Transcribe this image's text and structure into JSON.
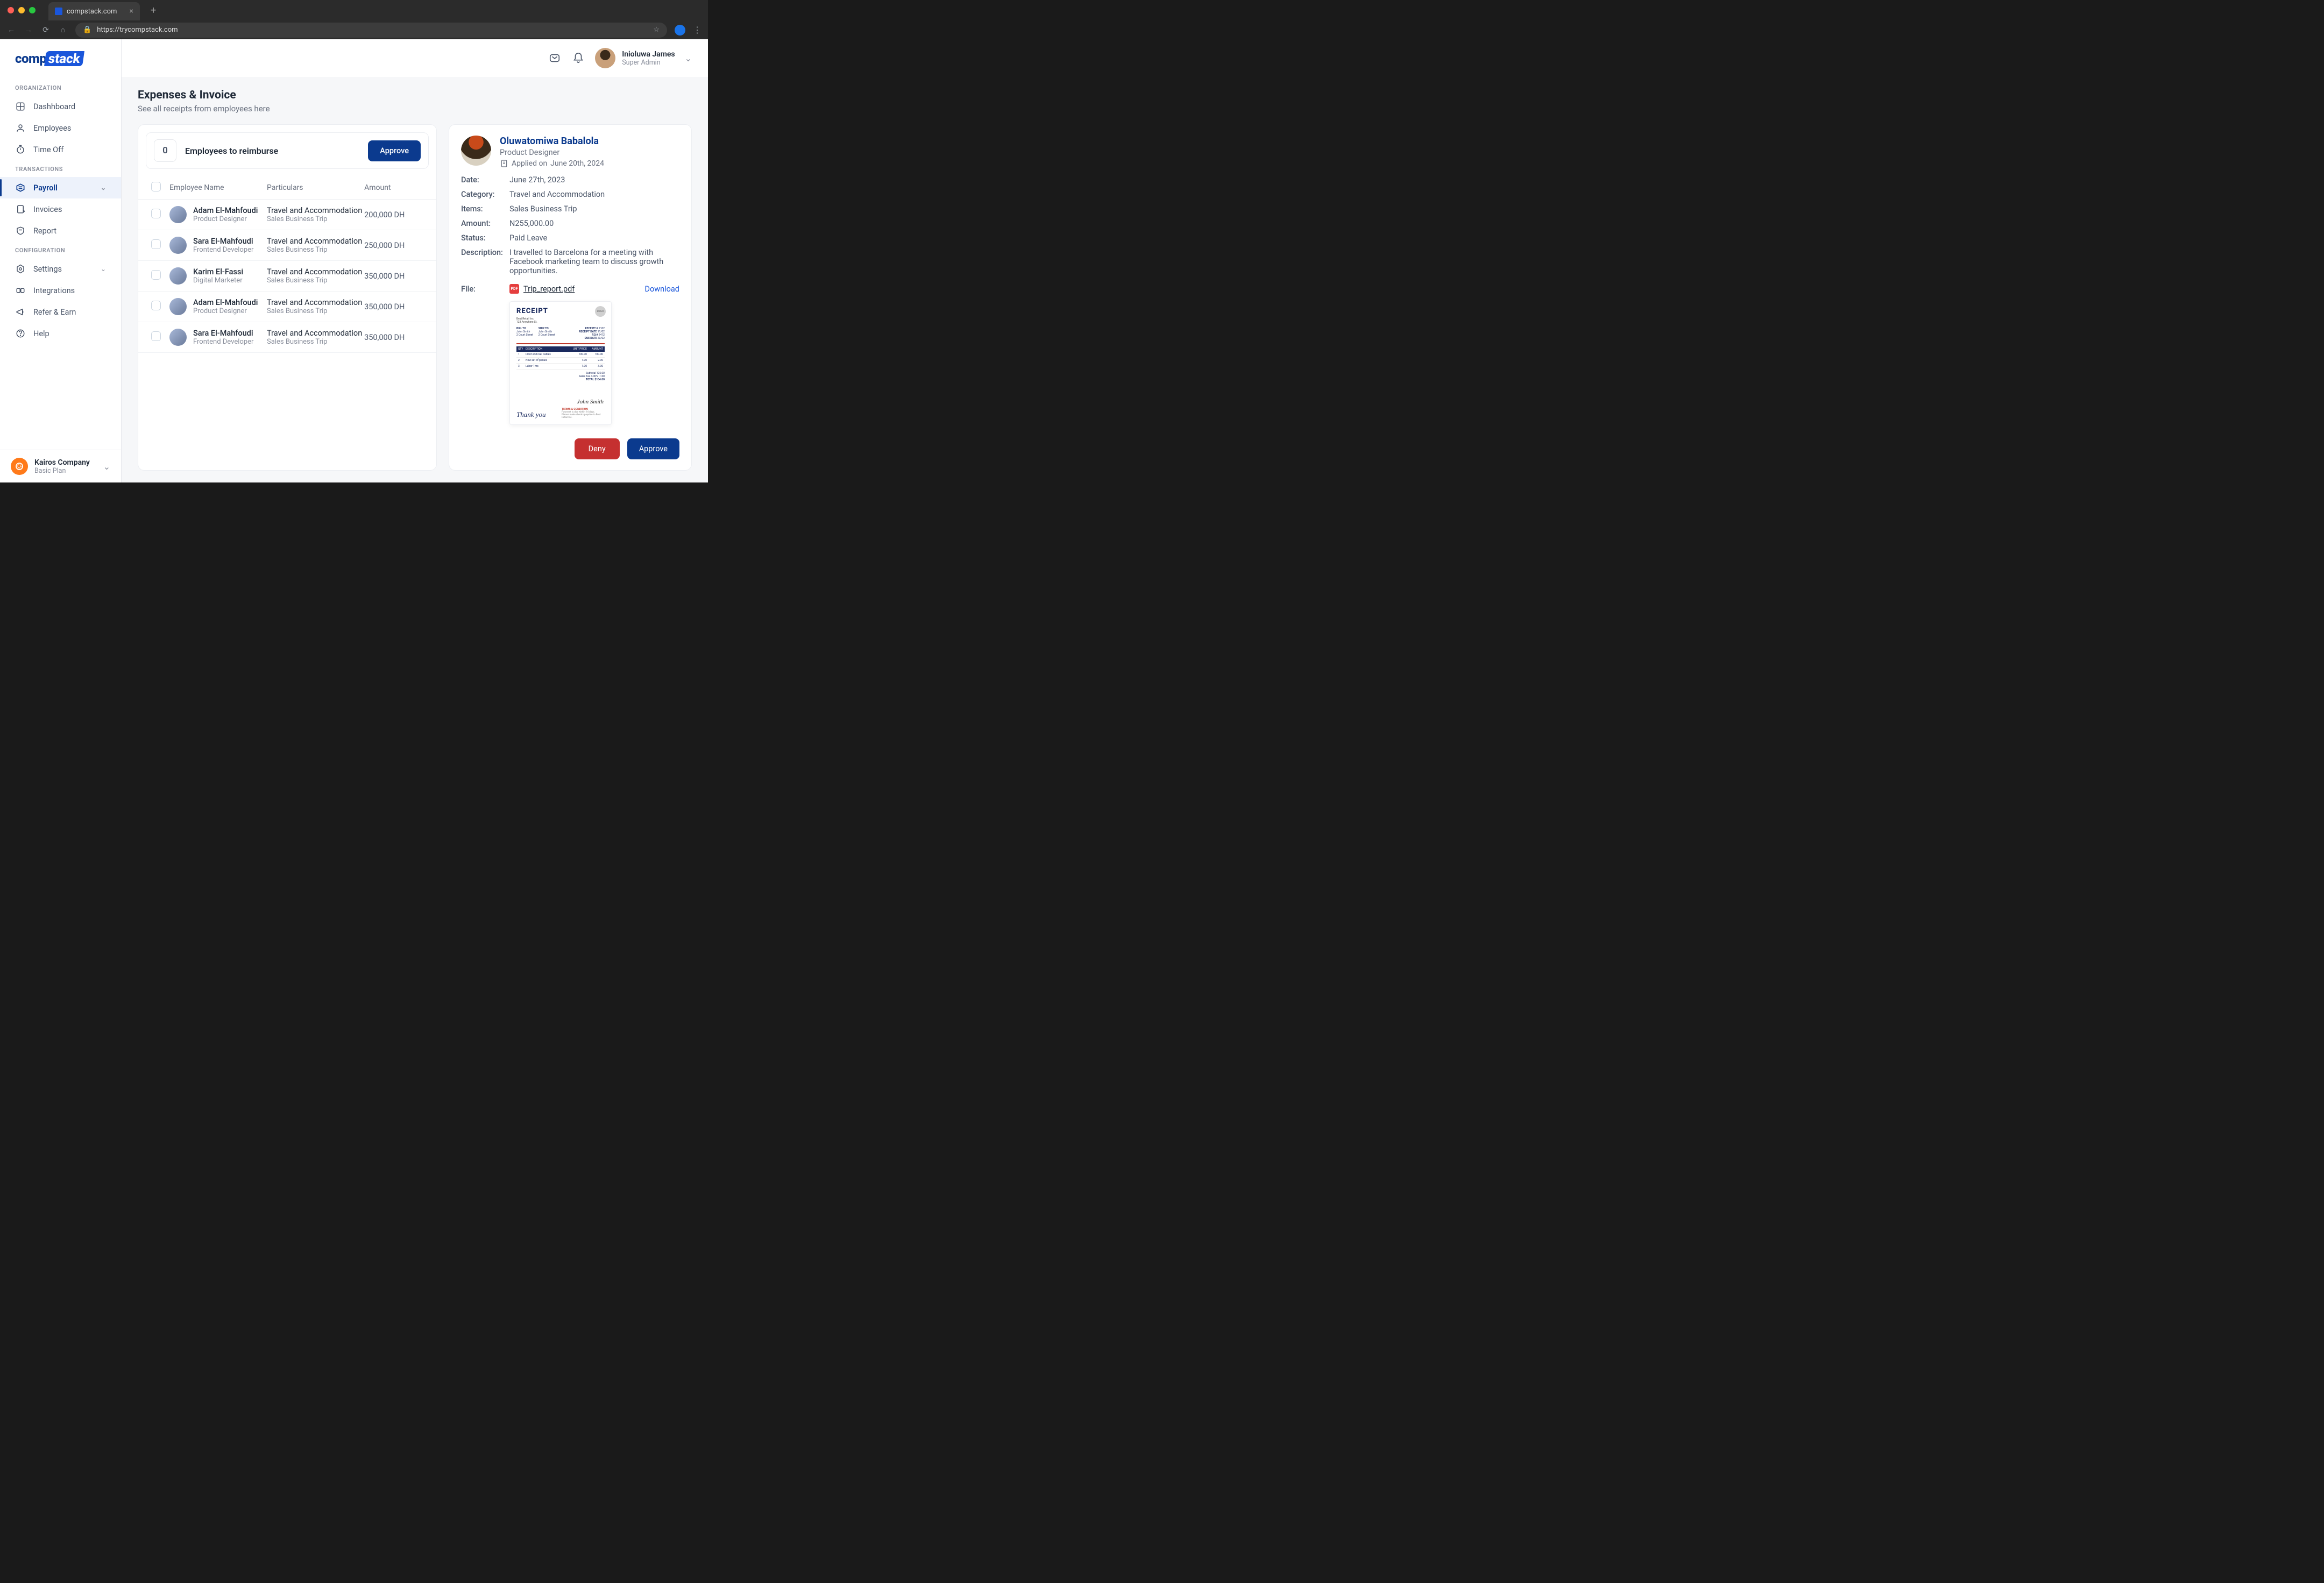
{
  "browser": {
    "tab_title": "compstack.com",
    "url": "https://trycompstack.com"
  },
  "logo": {
    "part1": "comp",
    "part2": "stack"
  },
  "sidebar": {
    "sections": {
      "organization": "ORGANIZATION",
      "transactions": "TRANSACTIONS",
      "configuration": "CONFIGURATION"
    },
    "items": {
      "dashboard": "Dashhboard",
      "employees": "Employees",
      "timeoff": "Time Off",
      "payroll": "Payroll",
      "invoices": "Invoices",
      "report": "Report",
      "settings": "Settings",
      "integrations": "Integrations",
      "refer": "Refer & Earn",
      "help": "Help"
    }
  },
  "company": {
    "name": "Kairos Company",
    "plan": "Basic Plan"
  },
  "user": {
    "name": "Inioluwa James",
    "role": "Super Admin"
  },
  "page": {
    "title": "Expenses & Invoice",
    "subtitle": "See all receipts from employees here"
  },
  "reimburse": {
    "count": "0",
    "label": "Employees to reimburse",
    "approve": "Approve"
  },
  "table": {
    "headers": {
      "name": "Employee Name",
      "particulars": "Particulars",
      "amount": "Amount"
    },
    "rows": [
      {
        "name": "Adam El-Mahfoudi",
        "role": "Product Designer",
        "particular": "Travel and Accommodation",
        "sub": "Sales Business Trip",
        "amount": "200,000 DH"
      },
      {
        "name": "Sara El-Mahfoudi",
        "role": "Frontend Developer",
        "particular": "Travel and Accommodation",
        "sub": "Sales Business Trip",
        "amount": "250,000 DH"
      },
      {
        "name": "Karim El-Fassi",
        "role": "Digital Marketer",
        "particular": "Travel and Accommodation",
        "sub": "Sales Business Trip",
        "amount": "350,000 DH"
      },
      {
        "name": "Adam El-Mahfoudi",
        "role": "Product Designer",
        "particular": "Travel and Accommodation",
        "sub": "Sales Business Trip",
        "amount": "350,000 DH"
      },
      {
        "name": "Sara El-Mahfoudi",
        "role": "Frontend Developer",
        "particular": "Travel and Accommodation",
        "sub": "Sales Business Trip",
        "amount": "350,000 DH"
      }
    ]
  },
  "detail": {
    "name": "Oluwatomiwa Babalola",
    "role": "Product Designer",
    "applied_prefix": "Applied on ",
    "applied_date": "June 20th, 2024",
    "labels": {
      "date": "Date:",
      "category": "Category:",
      "items": "Items:",
      "amount": "Amount:",
      "status": "Status:",
      "description": "Description:",
      "file": "File:"
    },
    "date": "June 27th, 2023",
    "category": "Travel and Accommodation",
    "items": "Sales Business Trip",
    "amount": "N255,000.00",
    "status": "Paid Leave",
    "description": "I travelled to Barcelona for a meeting with Facebook marketing team to discuss growth opportunities.",
    "file_name": "Trip_report.pdf",
    "download": "Download",
    "deny": "Deny",
    "approve": "Approve"
  },
  "receipt": {
    "title": "RECEIPT",
    "logo": "LOGO",
    "thankyou": "Thank you",
    "signature": "John Smith",
    "terms_header": "TERMS & CONDITION",
    "total_label": "TOTAL",
    "total": "$104.00"
  }
}
